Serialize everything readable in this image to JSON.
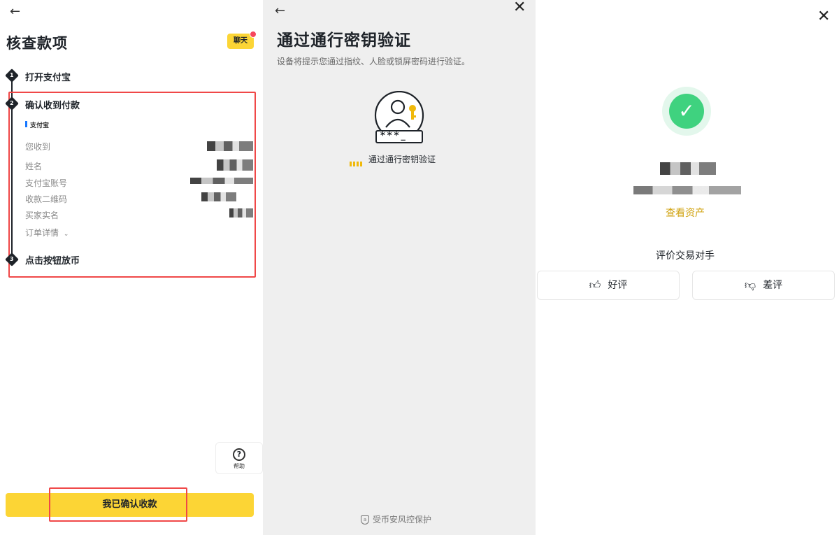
{
  "panel1": {
    "title": "核查款项",
    "chat_label": "聊天",
    "steps": [
      {
        "num": "1",
        "label": "打开支付宝"
      },
      {
        "num": "2",
        "label": "确认收到付款"
      },
      {
        "num": "3",
        "label": "点击按钮放币"
      }
    ],
    "payment_method": "支付宝",
    "rows": [
      {
        "label": "您收到"
      },
      {
        "label": "姓名"
      },
      {
        "label": "支付宝账号"
      },
      {
        "label": "收款二维码"
      },
      {
        "label": "买家实名"
      }
    ],
    "order_details": "订单详情",
    "help_label": "帮助",
    "confirm_button": "我已确认收款"
  },
  "panel2": {
    "title": "通过通行密钥验证",
    "description": "设备将提示您通过指纹、人脸或锁屏密码进行验证。",
    "password_mask": "***_",
    "loading_text": "通过通行密钥验证",
    "protect_text": "受币安风控保护"
  },
  "panel3": {
    "view_assets": "查看资产",
    "rate_title": "评价交易对手",
    "good_label": "好评",
    "bad_label": "差评"
  },
  "colors": {
    "brand_yellow": "#fcd535",
    "highlight_red": "#f04848",
    "success_green": "#3fd27f",
    "link_gold": "#d0a20d"
  },
  "icons": [
    "back-arrow-icon",
    "close-icon",
    "passkey-icon",
    "shield-icon",
    "check-icon",
    "thumbs-up-icon",
    "thumbs-down-icon",
    "help-icon",
    "chevron-down-icon"
  ]
}
